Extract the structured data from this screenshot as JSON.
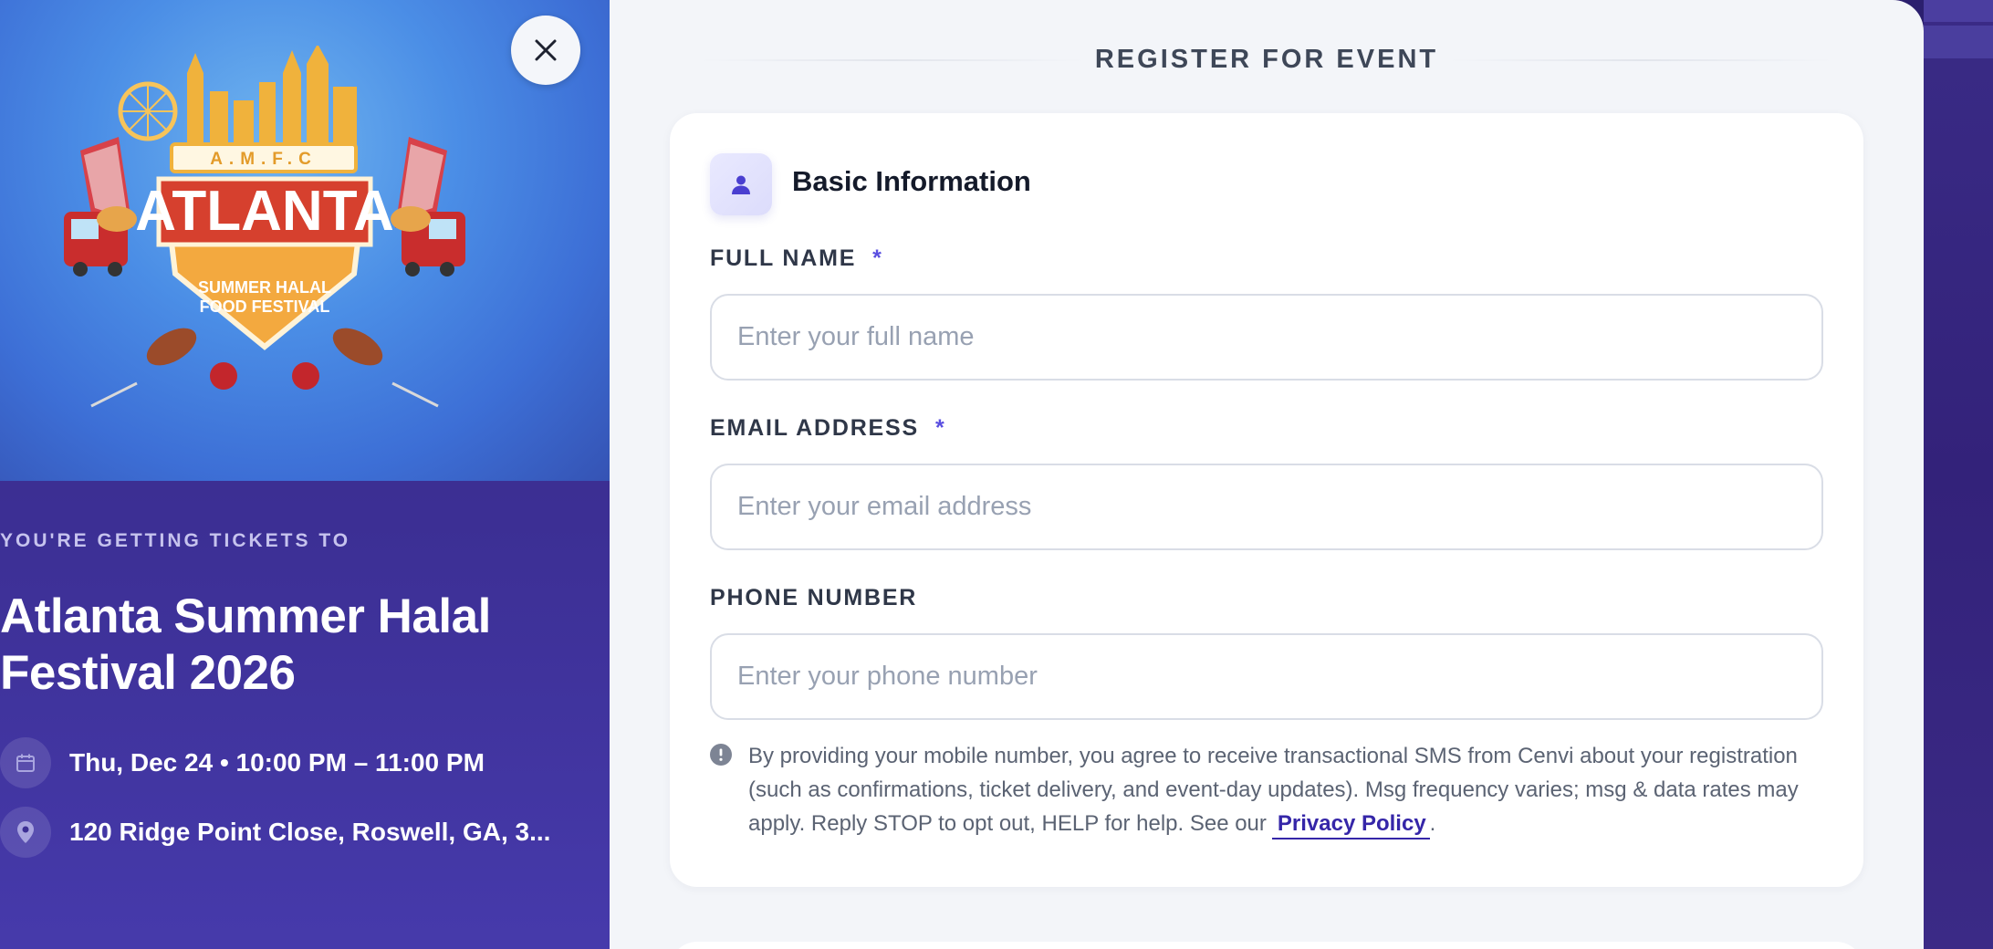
{
  "event": {
    "kicker": "YOU'RE GETTING TICKETS TO",
    "title": "Atlanta Summer Halal Festival 2026",
    "datetime": "Thu, Dec 24 • 10:00 PM – 11:00 PM",
    "location": "120 Ridge Point Close, Roswell, GA, 3...",
    "logo": {
      "top_text": "A.M.F.C",
      "main_text": "ATLANTA",
      "sub_text_line1": "SUMMER HALAL",
      "sub_text_line2": "FOOD FESTIVAL"
    },
    "icons": {
      "date": "calendar-icon",
      "location": "map-pin-icon",
      "close": "close-icon"
    }
  },
  "form": {
    "heading": "REGISTER FOR EVENT",
    "section_title": "Basic Information",
    "section_icon": "user-icon",
    "required_mark": "*",
    "fields": {
      "full_name": {
        "label": "FULL NAME",
        "placeholder": "Enter your full name",
        "required": true
      },
      "email": {
        "label": "EMAIL ADDRESS",
        "placeholder": "Enter your email address",
        "required": true
      },
      "phone": {
        "label": "PHONE NUMBER",
        "placeholder": "Enter your phone number",
        "required": false
      }
    },
    "sms_notice": "By providing your mobile number, you agree to receive transactional SMS from Cenvi about your registration (such as confirmations, ticket delivery, and event-day updates). Msg frequency varies; msg & data rates may apply. Reply STOP to opt out, HELP for help. See our",
    "privacy_link": "Privacy Policy",
    "sms_notice_end": "."
  },
  "colors": {
    "accent": "#5a4fe0",
    "link": "#3526a8",
    "panel_bg": "#f3f5f9",
    "event_panel": "#3c2f94"
  }
}
